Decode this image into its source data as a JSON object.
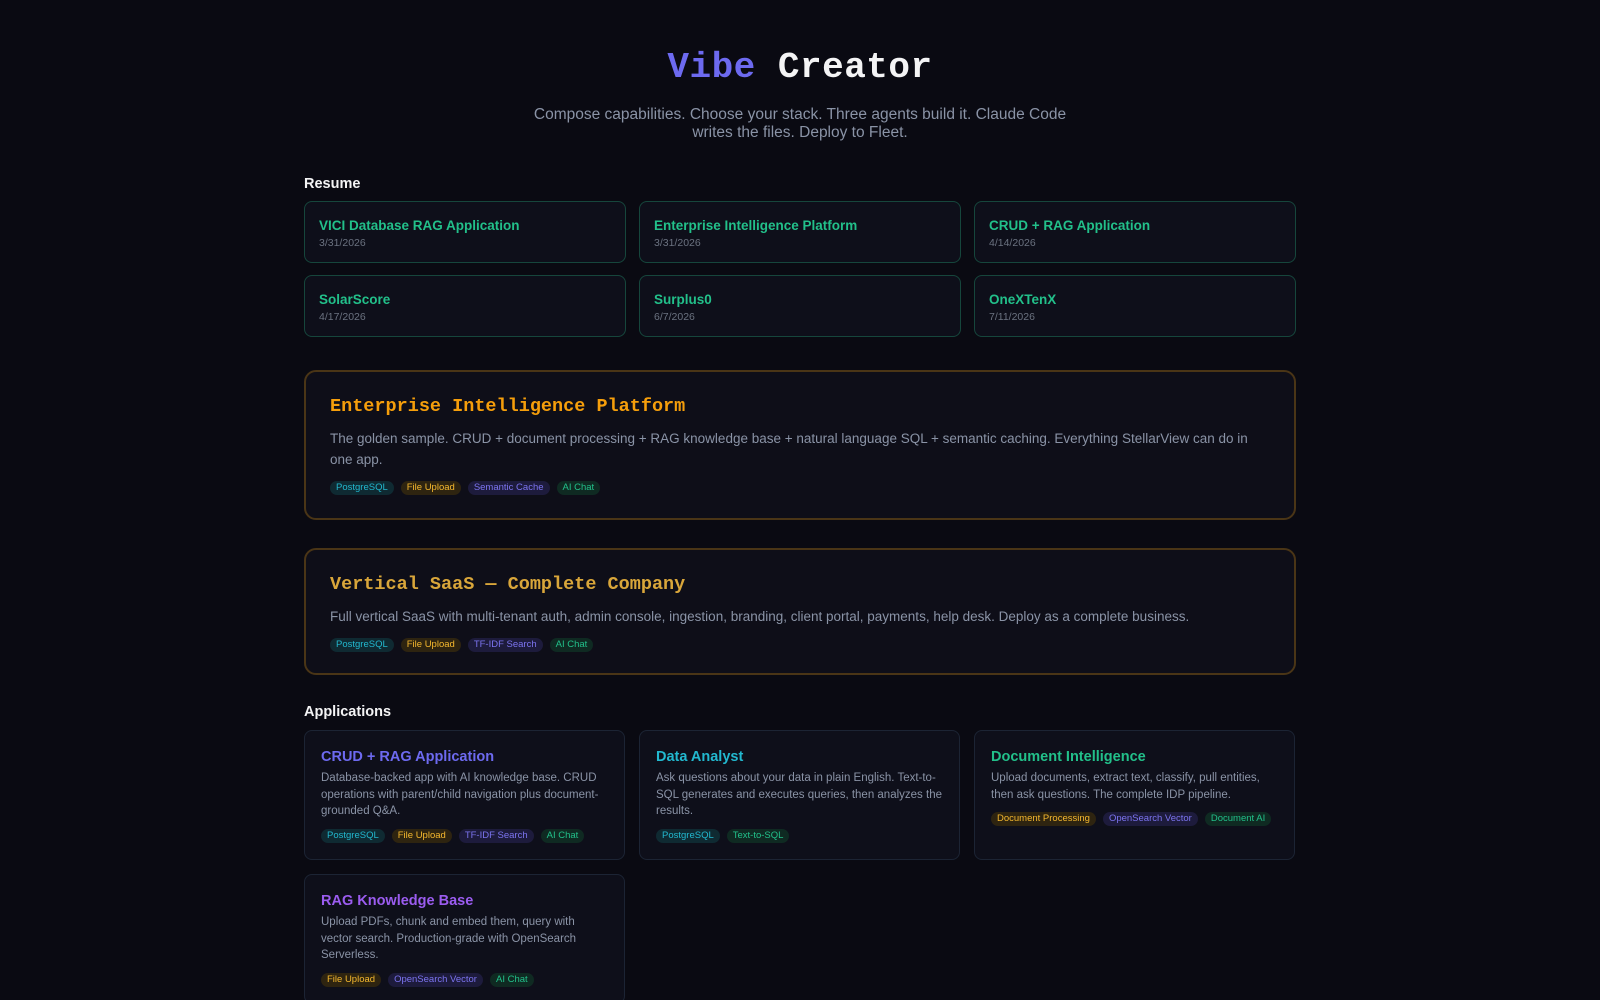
{
  "header": {
    "title_part1": "Vibe",
    "title_part2": "Creator",
    "subtitle": "Compose capabilities. Choose your stack. Three agents build it. Claude Code writes the files. Deploy to Fleet."
  },
  "resume": {
    "label": "Resume",
    "items": [
      {
        "name": "VICI Database RAG Application",
        "date": "3/31/2026"
      },
      {
        "name": "Enterprise Intelligence Platform",
        "date": "3/31/2026"
      },
      {
        "name": "CRUD + RAG Application",
        "date": "4/14/2026"
      },
      {
        "name": "SolarScore",
        "date": "4/17/2026"
      },
      {
        "name": "Surplus0",
        "date": "6/7/2026"
      },
      {
        "name": "OneXTenX",
        "date": "7/11/2026"
      }
    ]
  },
  "featured": [
    {
      "title": "Enterprise Intelligence Platform",
      "title_color": "#f59e0b",
      "description": "The golden sample. CRUD + document processing + RAG knowledge base + natural language SQL + semantic caching. Everything StellarView can do in one app.",
      "tags": [
        {
          "label": "PostgreSQL",
          "color": "cyan"
        },
        {
          "label": "File Upload",
          "color": "yellow"
        },
        {
          "label": "Semantic Cache",
          "color": "purple"
        },
        {
          "label": "AI Chat",
          "color": "green"
        }
      ]
    },
    {
      "title": "Vertical SaaS — Complete Company",
      "title_color": "#d9a63a",
      "description": "Full vertical SaaS with multi-tenant auth, admin console, ingestion, branding, client portal, payments, help desk. Deploy as a complete business.",
      "tags": [
        {
          "label": "PostgreSQL",
          "color": "cyan"
        },
        {
          "label": "File Upload",
          "color": "yellow"
        },
        {
          "label": "TF-IDF Search",
          "color": "purple"
        },
        {
          "label": "AI Chat",
          "color": "green"
        }
      ]
    }
  ],
  "applications": {
    "label": "Applications",
    "items": [
      {
        "name": "CRUD + RAG Application",
        "name_color": "#6d6af0",
        "description": "Database-backed app with AI knowledge base. CRUD operations with parent/child navigation plus document-grounded Q&A.",
        "tags": [
          {
            "label": "PostgreSQL",
            "color": "cyan"
          },
          {
            "label": "File Upload",
            "color": "yellow"
          },
          {
            "label": "TF-IDF Search",
            "color": "purple"
          },
          {
            "label": "AI Chat",
            "color": "green"
          }
        ]
      },
      {
        "name": "Data Analyst",
        "name_color": "#22b8cf",
        "description": "Ask questions about your data in plain English. Text-to-SQL generates and executes queries, then analyzes the results.",
        "tags": [
          {
            "label": "PostgreSQL",
            "color": "cyan"
          },
          {
            "label": "Text-to-SQL",
            "color": "green"
          }
        ]
      },
      {
        "name": "Document Intelligence",
        "name_color": "#22c08a",
        "description": "Upload documents, extract text, classify, pull entities, then ask questions. The complete IDP pipeline.",
        "tags": [
          {
            "label": "Document Processing",
            "color": "yellow"
          },
          {
            "label": "OpenSearch Vector",
            "color": "purple"
          },
          {
            "label": "Document AI",
            "color": "green"
          }
        ]
      },
      {
        "name": "RAG Knowledge Base",
        "name_color": "#9b5cf0",
        "description": "Upload PDFs, chunk and embed them, query with vector search. Production-grade with OpenSearch Serverless.",
        "tags": [
          {
            "label": "File Upload",
            "color": "yellow"
          },
          {
            "label": "OpenSearch Vector",
            "color": "purple"
          },
          {
            "label": "AI Chat",
            "color": "green"
          }
        ]
      }
    ]
  }
}
